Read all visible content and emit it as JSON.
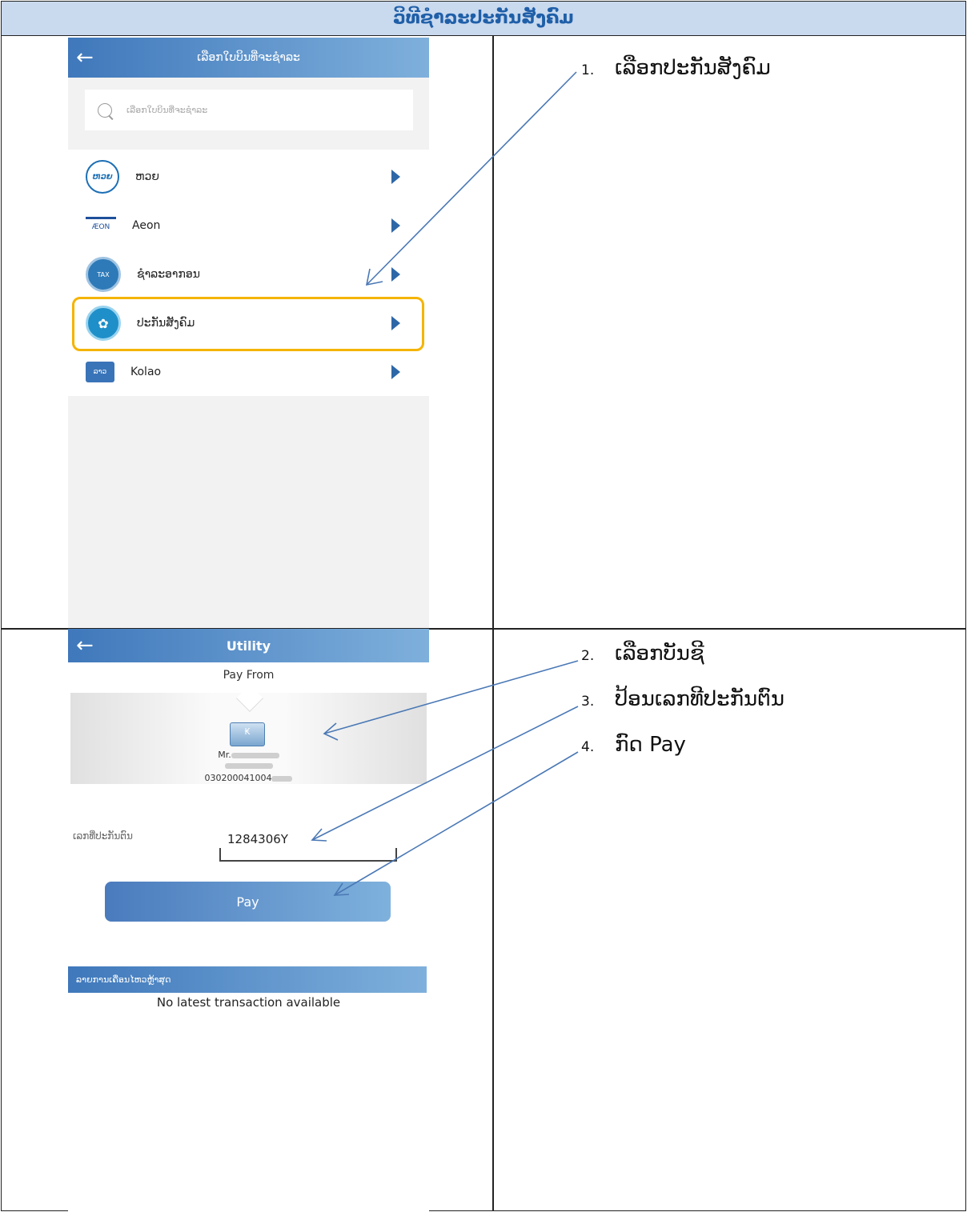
{
  "document": {
    "title": "ວິທີຊຳລະປະກັນສັງຄົມ"
  },
  "screen1": {
    "header_title": "ເລືອກໃບບິນທີ່ຈະຊຳລະ",
    "back_icon": "arrow-left-icon",
    "search_placeholder": "ເລືອກໃບບິນທີ່ຈະຊຳລະ",
    "items": [
      {
        "label": "ຫວຍ",
        "logo": "lottery-logo",
        "color": "#1c6fb5"
      },
      {
        "label": "Aeon",
        "logo": "aeon-logo",
        "color": "#1e4f9a"
      },
      {
        "label": "ຊຳລະອາກອນ",
        "logo": "tax-logo",
        "color": "#2e7ab8"
      },
      {
        "label": "ປະກັນສັງຄົມ",
        "logo": "social-security-logo",
        "color": "#1f8fc9"
      },
      {
        "label": "Kolao",
        "logo": "kolao-logo",
        "color": "#3a74b8"
      }
    ],
    "highlight_color": "#f5b400"
  },
  "screen2": {
    "header_title": "Utility",
    "pay_from_label": "Pay From",
    "card_icon_symbol": "₭",
    "account_name_prefix": "Mr.",
    "account_number_prefix": "030200041004",
    "field_label": "ເລກທີ່ປະກັນຕົນ",
    "field_value": "1284306Y",
    "pay_button": "Pay",
    "recent_header": "ລາຍການເຄື່ອນໄຫວຫຼ້າສຸດ",
    "no_transactions": "No latest transaction available"
  },
  "steps": [
    {
      "num": "1.",
      "text": "ເລືອກປະກັນສັງຄົມ"
    },
    {
      "num": "2.",
      "text": "ເລືອກບັນຊີ"
    },
    {
      "num": "3.",
      "text": "ປ້ອນເລກທີປະກັນຕົນ"
    },
    {
      "num": "4.",
      "text": "ກົດ Pay"
    }
  ],
  "colors": {
    "accent": "#3f78bb",
    "title_bg": "#c9d9ee",
    "title_text": "#1f5fa8",
    "arrow_line": "#4a78b5"
  }
}
